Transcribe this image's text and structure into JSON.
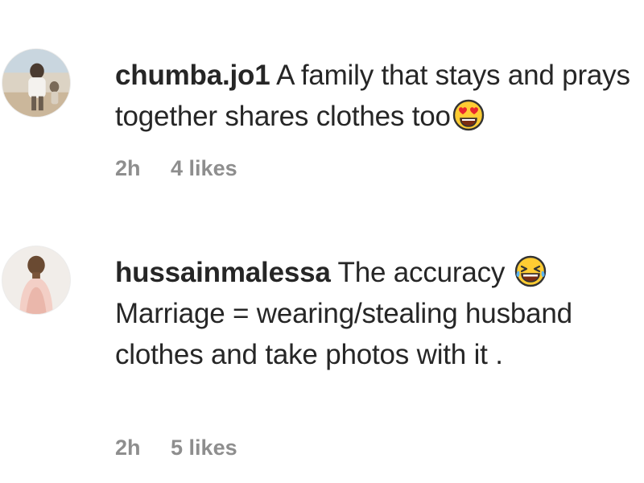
{
  "comments": [
    {
      "username": "chumba.jo1",
      "text": "A family that stays and prays together shares clothes too",
      "emoji": "heart-eyes-emoji",
      "time": "2h",
      "likes": "4 likes"
    },
    {
      "username": "hussainmalessa",
      "text_line1": "The accuracy",
      "emoji": "laughing-tears-emoji",
      "text_rest": "Marriage = wearing/stealing husband clothes and take photos with it .",
      "time": "2h",
      "likes": "5 likes"
    }
  ]
}
